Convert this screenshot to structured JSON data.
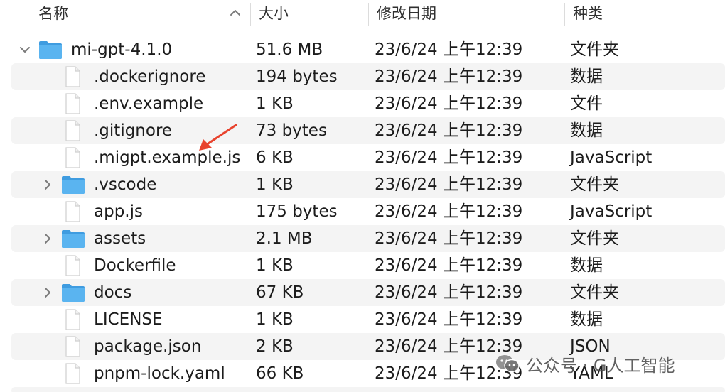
{
  "columns": {
    "name": "名称",
    "size": "大小",
    "modified": "修改日期",
    "kind": "种类"
  },
  "sort": {
    "column": "name",
    "direction": "ascending",
    "icon": "chevron-up-icon"
  },
  "rows": [
    {
      "name": "mi-gpt-4.1.0",
      "size": "51.6 MB",
      "date": "23/6/24 上午12:39",
      "kind": "文件夹",
      "type": "folder",
      "expanded": true,
      "level": 0
    },
    {
      "name": ".dockerignore",
      "size": "194 bytes",
      "date": "23/6/24 上午12:39",
      "kind": "数据",
      "type": "file",
      "level": 1
    },
    {
      "name": ".env.example",
      "size": "1 KB",
      "date": "23/6/24 上午12:39",
      "kind": "文件",
      "type": "file",
      "level": 1
    },
    {
      "name": ".gitignore",
      "size": "73 bytes",
      "date": "23/6/24 上午12:39",
      "kind": "数据",
      "type": "file",
      "level": 1
    },
    {
      "name": ".migpt.example.js",
      "size": "6 KB",
      "date": "23/6/24 上午12:39",
      "kind": "JavaScript",
      "type": "file",
      "level": 1
    },
    {
      "name": ".vscode",
      "size": "1 KB",
      "date": "23/6/24 上午12:39",
      "kind": "文件夹",
      "type": "folder",
      "expanded": false,
      "level": 1
    },
    {
      "name": "app.js",
      "size": "175 bytes",
      "date": "23/6/24 上午12:39",
      "kind": "JavaScript",
      "type": "file",
      "level": 1
    },
    {
      "name": "assets",
      "size": "2.1 MB",
      "date": "23/6/24 上午12:39",
      "kind": "文件夹",
      "type": "folder",
      "expanded": false,
      "level": 1
    },
    {
      "name": "Dockerfile",
      "size": "1 KB",
      "date": "23/6/24 上午12:39",
      "kind": "数据",
      "type": "file",
      "level": 1
    },
    {
      "name": "docs",
      "size": "67 KB",
      "date": "23/6/24 上午12:39",
      "kind": "文件夹",
      "type": "folder",
      "expanded": false,
      "level": 1
    },
    {
      "name": "LICENSE",
      "size": "1 KB",
      "date": "23/6/24 上午12:39",
      "kind": "数据",
      "type": "file",
      "level": 1
    },
    {
      "name": "package.json",
      "size": "2 KB",
      "date": "23/6/24 上午12:39",
      "kind": "JSON",
      "type": "file",
      "level": 1
    },
    {
      "name": "pnpm-lock.yaml",
      "size": "66 KB",
      "date": "23/6/24 上午12:39",
      "kind": "YAML",
      "type": "file",
      "level": 1
    }
  ],
  "annotation": {
    "target": ".migpt.example.js",
    "color": "#e8432e",
    "icon": "red-arrow-icon"
  },
  "watermark": {
    "text": "公众号 · G人工智能",
    "icon": "wechat-logo-icon"
  },
  "colors": {
    "folder": "#5ab4f0",
    "folder_dark": "#3f9ce0",
    "alt_row": "#f4f4f4",
    "text": "#1c1c1c"
  }
}
